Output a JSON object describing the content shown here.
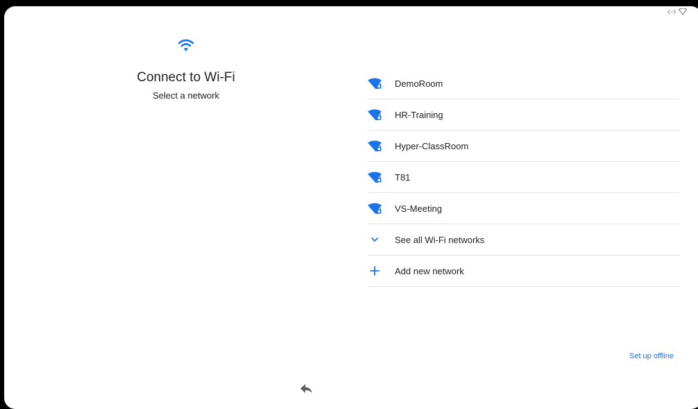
{
  "header": {
    "title": "Connect to Wi-Fi",
    "subtitle": "Select a network"
  },
  "networks": [
    {
      "ssid": "DemoRoom",
      "icon": "wifi-locked-icon"
    },
    {
      "ssid": "HR-Training",
      "icon": "wifi-locked-icon"
    },
    {
      "ssid": "Hyper-ClassRoom",
      "icon": "wifi-locked-icon"
    },
    {
      "ssid": "T81",
      "icon": "wifi-locked-icon"
    },
    {
      "ssid": "VS-Meeting",
      "icon": "wifi-locked-icon"
    }
  ],
  "actions": {
    "see_all": "See all Wi-Fi networks",
    "add_network": "Add new network",
    "setup_offline": "Set up offline"
  },
  "colors": {
    "accent": "#1a73e8",
    "text": "#202124",
    "divider": "#e3e3e3"
  }
}
